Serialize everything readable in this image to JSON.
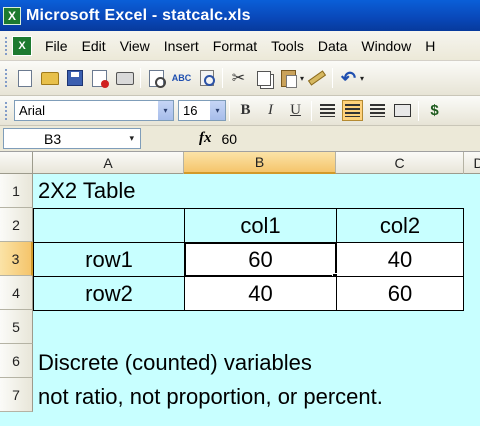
{
  "window": {
    "title": "Microsoft Excel - statcalc.xls",
    "app_icon": "X"
  },
  "menu": {
    "doc_icon": "X",
    "items": [
      "File",
      "Edit",
      "View",
      "Insert",
      "Format",
      "Tools",
      "Data",
      "Window",
      "H"
    ]
  },
  "toolbar": {
    "cut_glyph": "✂",
    "undo_glyph": "↶",
    "dropdown_glyph": "▾"
  },
  "format": {
    "font": "Arial",
    "size": "16",
    "bold": "B",
    "italic": "I",
    "underline": "U",
    "currency": "$"
  },
  "formula_bar": {
    "cell_ref": "B3",
    "fx": "fx",
    "value": "60"
  },
  "grid": {
    "columns": [
      "A",
      "B",
      "C",
      "D"
    ],
    "active_column": "B",
    "rows": [
      "1",
      "2",
      "3",
      "4",
      "5",
      "6",
      "7"
    ],
    "active_row": "3"
  },
  "sheet": {
    "title": "2X2 Table",
    "col_headers": [
      "col1",
      "col2"
    ],
    "table": [
      {
        "label": "row1",
        "values": [
          "60",
          "40"
        ]
      },
      {
        "label": "row2",
        "values": [
          "40",
          "60"
        ]
      }
    ],
    "note_line1": "Discrete (counted) variables",
    "note_line2": "not ratio, not proportion, or percent."
  },
  "colors": {
    "sheet_background": "#c8ffff",
    "title_bar": "#0a5fd8",
    "selection_header": "#f5c56b"
  }
}
